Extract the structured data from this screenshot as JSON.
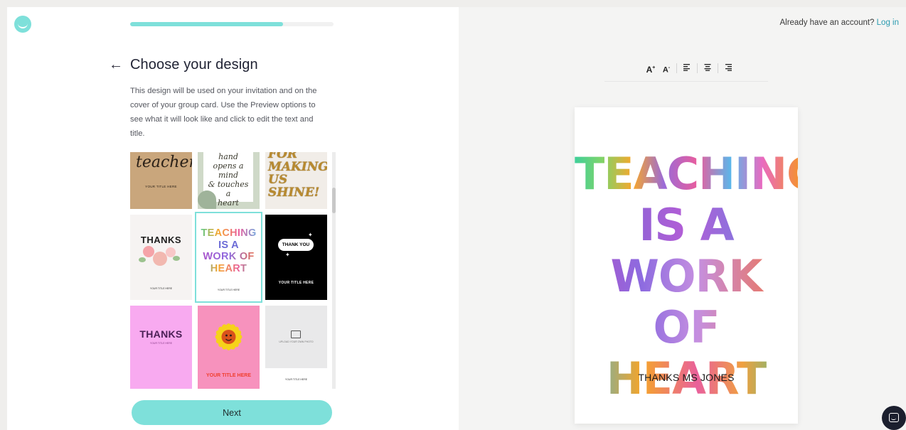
{
  "app": {
    "brand_color": "#7ee0da",
    "accent_link_color": "#2a9bb0"
  },
  "progress": {
    "value": 0.75
  },
  "header": {
    "title": "Choose your design",
    "description": "This design will be used on your invitation and on the cover of your group card. Use the Preview options to see what it will look like and click to edit the text and title."
  },
  "account": {
    "prompt": "Already have an account?",
    "login_label": "Log in"
  },
  "designs": {
    "kraft": {
      "script": "teacher",
      "subtitle": "YOUR TITLE HERE"
    },
    "sage": {
      "lines": "hand\nopens a\nmind\n& touches a\nheart"
    },
    "gold": {
      "text": "FOR MAKING US SHINE!"
    },
    "flower": {
      "word": "THANKS",
      "subtitle": "YOUR TITLE HERE"
    },
    "teach": {
      "line1": "TEACHING",
      "line2": "IS A",
      "line3": "WORK OF",
      "line4": "HEART",
      "subtitle": "YOUR TITLE HERE"
    },
    "black": {
      "bubble": "THANK YOU",
      "subtitle": "YOUR TITLE HERE"
    },
    "pink": {
      "word": "THANKS",
      "subtitle": "YOUR TITLE HERE"
    },
    "sun": {
      "subtitle": "YOUR TITLE HERE"
    },
    "photo": {
      "upload": "UPLOAD YOUR OWN PHOTO",
      "subtitle": "YOUR TITLE HERE"
    }
  },
  "next_label": "Next",
  "toolbar": {
    "icons": [
      "increase-font-icon",
      "decrease-font-icon",
      "align-left-icon",
      "align-center-icon",
      "align-right-icon"
    ]
  },
  "preview": {
    "line1": "TEACHING",
    "line2": "IS A",
    "line3": "WORK OF",
    "line4": "HEART",
    "subtitle": "THANKS MS JONES"
  }
}
